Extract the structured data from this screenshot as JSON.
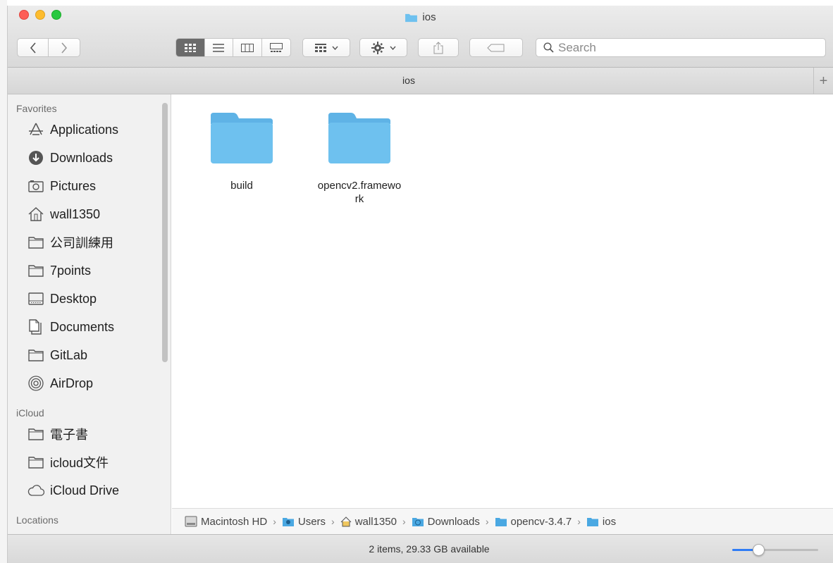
{
  "window": {
    "title": "ios"
  },
  "toolbar": {
    "back_icon": "chevron-left-icon",
    "forward_icon": "chevron-right-icon",
    "view_modes": [
      "icon-view-icon",
      "list-view-icon",
      "column-view-icon",
      "gallery-view-icon"
    ],
    "group_icon": "group-by-icon",
    "action_icon": "gear-icon",
    "share_icon": "share-icon",
    "tag_icon": "tag-icon",
    "search_placeholder": "Search"
  },
  "tabbar": {
    "label": "ios"
  },
  "sidebar": {
    "sections": [
      {
        "title": "Favorites",
        "items": [
          {
            "label": "Applications",
            "icon": "applications-icon"
          },
          {
            "label": "Downloads",
            "icon": "downloads-icon"
          },
          {
            "label": "Pictures",
            "icon": "pictures-icon"
          },
          {
            "label": "wall1350",
            "icon": "home-icon"
          },
          {
            "label": "公司訓練用",
            "icon": "folder-icon"
          },
          {
            "label": "7points",
            "icon": "folder-icon"
          },
          {
            "label": "Desktop",
            "icon": "desktop-icon"
          },
          {
            "label": "Documents",
            "icon": "documents-icon"
          },
          {
            "label": "GitLab",
            "icon": "folder-icon"
          },
          {
            "label": "AirDrop",
            "icon": "airdrop-icon"
          }
        ]
      },
      {
        "title": "iCloud",
        "items": [
          {
            "label": "電子書",
            "icon": "folder-icon"
          },
          {
            "label": "icloud文件",
            "icon": "folder-icon"
          },
          {
            "label": "iCloud Drive",
            "icon": "cloud-icon"
          }
        ]
      },
      {
        "title": "Locations",
        "items": []
      }
    ]
  },
  "files": [
    {
      "name": "build"
    },
    {
      "name": "opencv2.framework"
    }
  ],
  "pathbar": {
    "crumbs": [
      "Macintosh HD",
      "Users",
      "wall1350",
      "Downloads",
      "opencv-3.4.7",
      "ios"
    ]
  },
  "status": {
    "text": "2 items, 29.33 GB available",
    "icon_size_level": 0.28
  },
  "colors": {
    "folder": "#6ec1ef",
    "folder_tab": "#5fb3e6",
    "accent": "#2f7cf6"
  }
}
